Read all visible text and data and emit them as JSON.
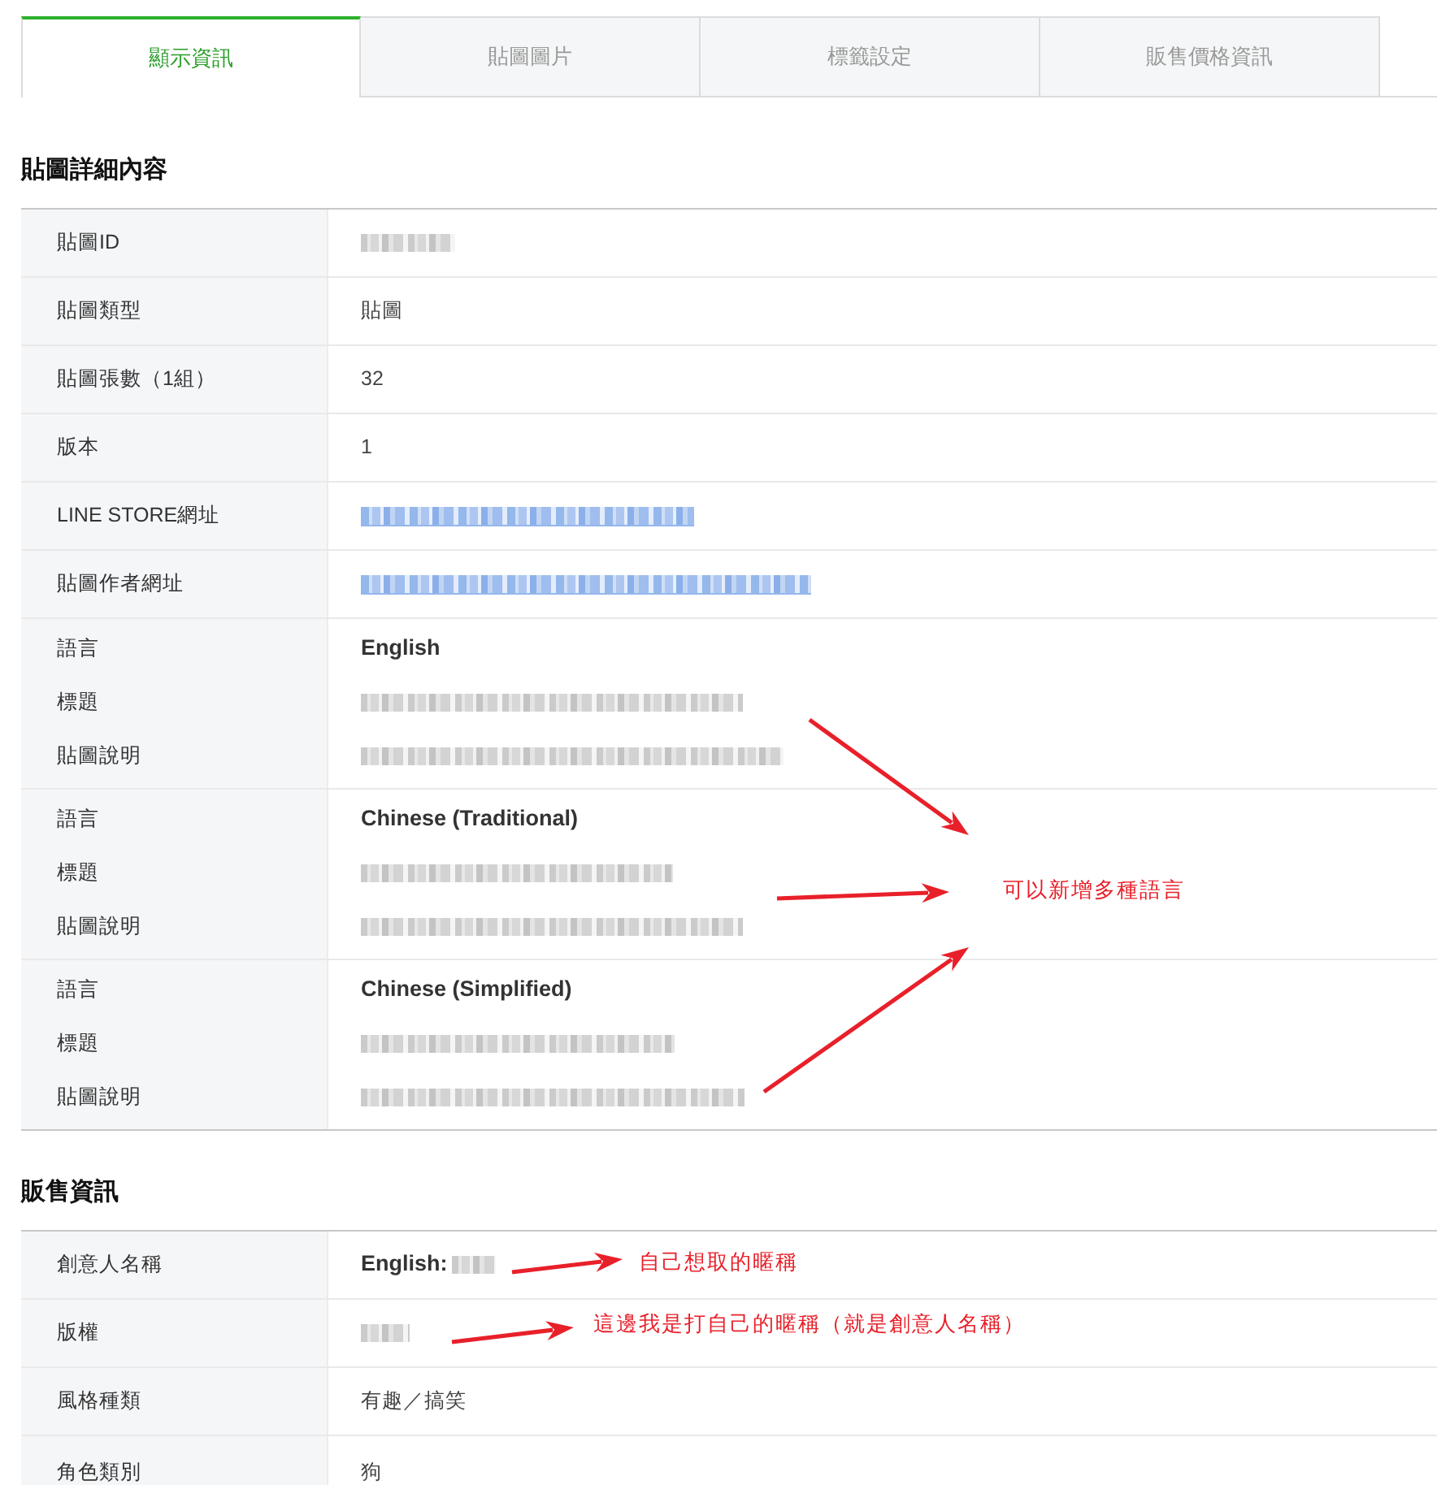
{
  "tabs": [
    {
      "label": "顯示資訊",
      "selected": true
    },
    {
      "label": "貼圖圖片",
      "selected": false
    },
    {
      "label": "標籤設定",
      "selected": false
    },
    {
      "label": "販售價格資訊",
      "selected": false
    }
  ],
  "sections": [
    {
      "heading": "貼圖詳細內容",
      "rows": [
        {
          "lines": [
            {
              "label": "貼圖ID",
              "kind": "blurred"
            }
          ]
        },
        {
          "lines": [
            {
              "label": "貼圖類型",
              "kind": "text",
              "value": "貼圖"
            }
          ]
        },
        {
          "lines": [
            {
              "label": "貼圖張數（1組）",
              "kind": "text",
              "value": "32"
            }
          ]
        },
        {
          "lines": [
            {
              "label": "版本",
              "kind": "text",
              "value": "1"
            }
          ]
        },
        {
          "lines": [
            {
              "label": "LINE STORE網址",
              "kind": "blurred_link"
            }
          ]
        },
        {
          "lines": [
            {
              "label": "貼圖作者網址",
              "kind": "blurred_link"
            }
          ]
        },
        {
          "lines": [
            {
              "label": "語言",
              "kind": "strong",
              "value": "English"
            },
            {
              "label": "標題",
              "kind": "blurred"
            },
            {
              "label": "貼圖說明",
              "kind": "blurred"
            }
          ]
        },
        {
          "lines": [
            {
              "label": "語言",
              "kind": "strong",
              "value": "Chinese (Traditional)"
            },
            {
              "label": "標題",
              "kind": "blurred"
            },
            {
              "label": "貼圖說明",
              "kind": "blurred"
            }
          ]
        },
        {
          "lines": [
            {
              "label": "語言",
              "kind": "strong",
              "value": "Chinese (Simplified)"
            },
            {
              "label": "標題",
              "kind": "blurred"
            },
            {
              "label": "貼圖說明",
              "kind": "blurred"
            }
          ]
        }
      ]
    },
    {
      "heading": "販售資訊",
      "rows": [
        {
          "lines": [
            {
              "label": "創意人名稱",
              "kind": "strong_blurred",
              "value": "English:"
            }
          ]
        },
        {
          "lines": [
            {
              "label": "版權",
              "kind": "blurred"
            }
          ]
        },
        {
          "lines": [
            {
              "label": "風格種類",
              "kind": "text",
              "value": "有趣／搞笑"
            }
          ]
        },
        {
          "lines": [
            {
              "label": "角色類別",
              "kind": "text",
              "value": "狗"
            }
          ]
        }
      ]
    }
  ],
  "annotations": [
    {
      "text": "可以新增多種語言"
    },
    {
      "text": "自己想取的暱稱"
    },
    {
      "text": "這邊我是打自己的暱稱（就是創意人名稱）"
    }
  ]
}
